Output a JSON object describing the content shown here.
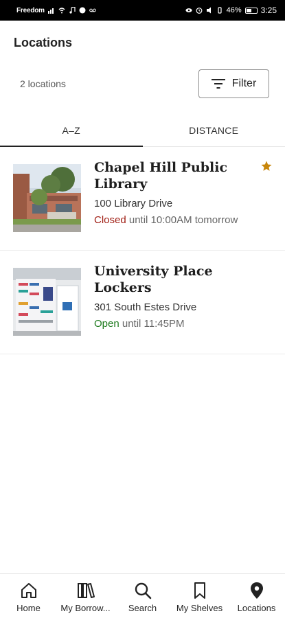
{
  "status_bar": {
    "carrier": "Freedom",
    "battery": "46%",
    "time": "3:25"
  },
  "header": {
    "title": "Locations",
    "count_label": "2 locations",
    "filter_label": "Filter"
  },
  "tabs": [
    {
      "label": "A–Z",
      "active": true
    },
    {
      "label": "DISTANCE",
      "active": false
    }
  ],
  "locations": [
    {
      "name": "Chapel Hill Public Library",
      "address": "100 Library Drive",
      "status": "Closed",
      "status_detail": " until 10:00AM tomorrow",
      "favorite": true
    },
    {
      "name": "University Place Lockers",
      "address": "301 South Estes Drive",
      "status": "Open",
      "status_detail": " until 11:45PM",
      "favorite": false
    }
  ],
  "nav": [
    {
      "label": "Home",
      "icon": "home-icon"
    },
    {
      "label": "My Borrow...",
      "icon": "books-icon"
    },
    {
      "label": "Search",
      "icon": "search-icon"
    },
    {
      "label": "My Shelves",
      "icon": "bookmark-icon"
    },
    {
      "label": "Locations",
      "icon": "location-pin-icon"
    }
  ],
  "colors": {
    "closed": "#a01e14",
    "open": "#1c7a1c",
    "star": "#c8860a"
  }
}
